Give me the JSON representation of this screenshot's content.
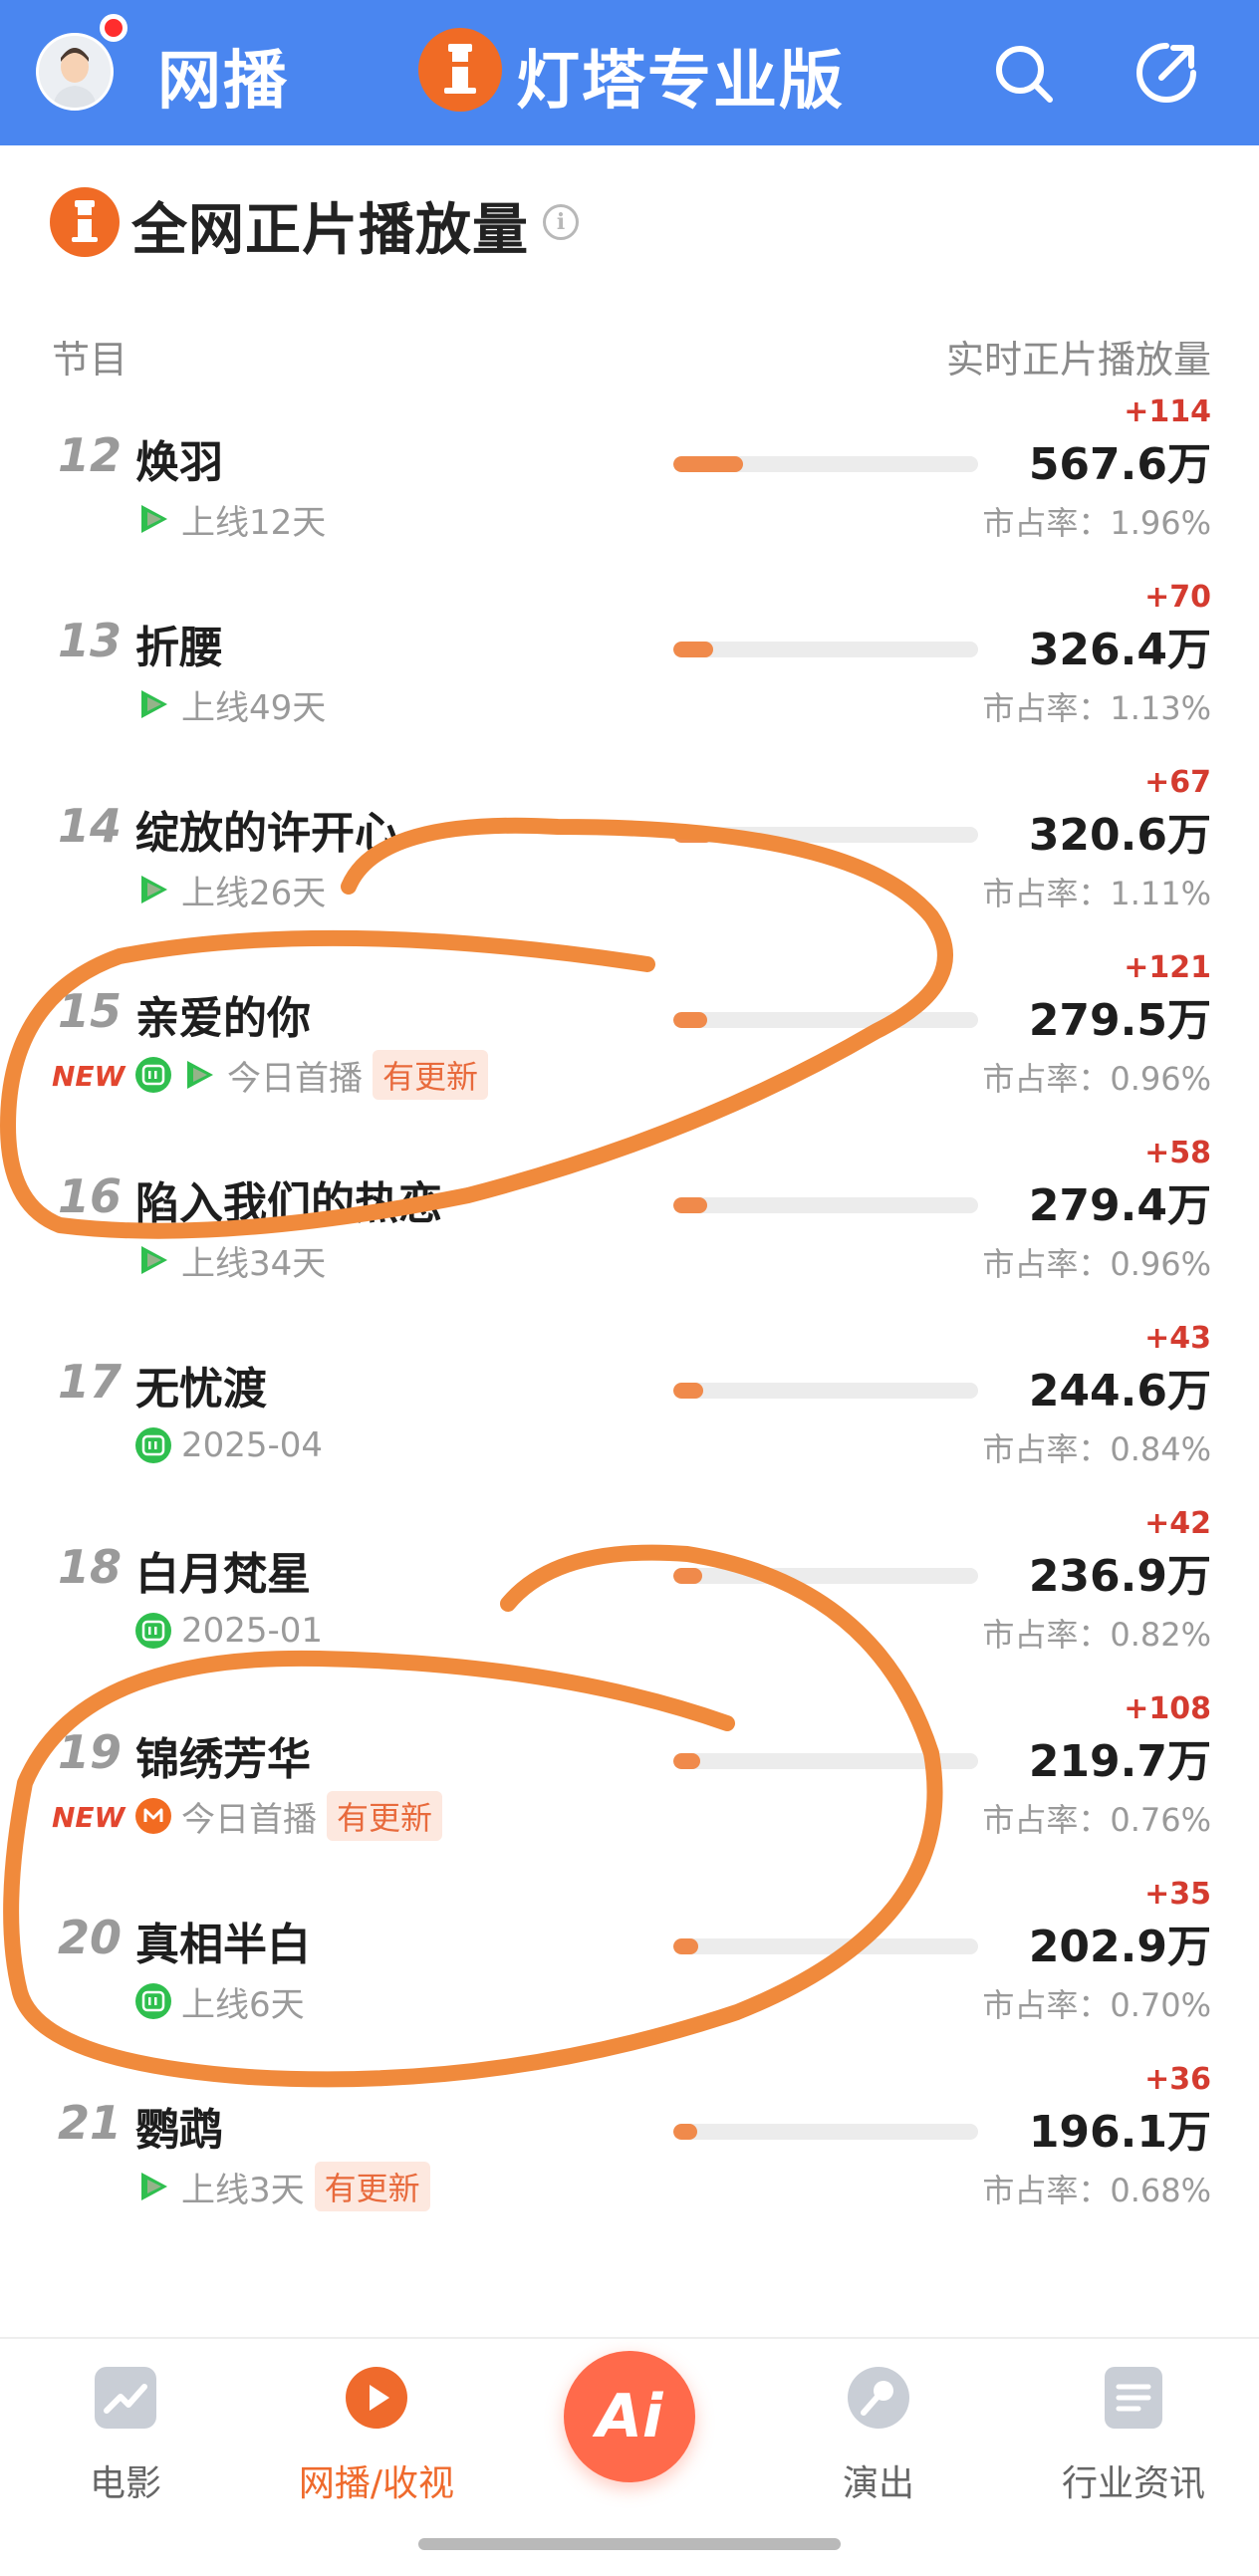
{
  "header": {
    "app_title": "网播",
    "brand_title": "灯塔专业版"
  },
  "section": {
    "title": "全网正片播放量",
    "col_left": "节目",
    "col_right": "实时正片播放量"
  },
  "rows": [
    {
      "rank": "12",
      "name": "焕羽",
      "platforms": [
        "tencent"
      ],
      "new": "",
      "meta_text": "上线12天",
      "update": "",
      "delta": "+114",
      "plays": "567.6万",
      "share": "市占率：1.96%",
      "share_value": 1.96
    },
    {
      "rank": "13",
      "name": "折腰",
      "platforms": [
        "tencent"
      ],
      "new": "",
      "meta_text": "上线49天",
      "update": "",
      "delta": "+70",
      "plays": "326.4万",
      "share": "市占率：1.13%",
      "share_value": 1.13
    },
    {
      "rank": "14",
      "name": "绽放的许开心",
      "platforms": [
        "tencent"
      ],
      "new": "",
      "meta_text": "上线26天",
      "update": "",
      "delta": "+67",
      "plays": "320.6万",
      "share": "市占率：1.11%",
      "share_value": 1.11
    },
    {
      "rank": "15",
      "name": "亲爱的你",
      "platforms": [
        "iqiyi",
        "tencent"
      ],
      "new": "NEW",
      "meta_text": "今日首播",
      "update": "有更新",
      "delta": "+121",
      "plays": "279.5万",
      "share": "市占率：0.96%",
      "share_value": 0.96
    },
    {
      "rank": "16",
      "name": "陷入我们的热恋",
      "platforms": [
        "tencent"
      ],
      "new": "",
      "meta_text": "上线34天",
      "update": "",
      "delta": "+58",
      "plays": "279.4万",
      "share": "市占率：0.96%",
      "share_value": 0.96
    },
    {
      "rank": "17",
      "name": "无忧渡",
      "platforms": [
        "iqiyi"
      ],
      "new": "",
      "meta_text": "2025-04",
      "update": "",
      "delta": "+43",
      "plays": "244.6万",
      "share": "市占率：0.84%",
      "share_value": 0.84
    },
    {
      "rank": "18",
      "name": "白月梵星",
      "platforms": [
        "iqiyi"
      ],
      "new": "",
      "meta_text": "2025-01",
      "update": "",
      "delta": "+42",
      "plays": "236.9万",
      "share": "市占率：0.82%",
      "share_value": 0.82
    },
    {
      "rank": "19",
      "name": "锦绣芳华",
      "platforms": [
        "mgtv"
      ],
      "new": "NEW",
      "meta_text": "今日首播",
      "update": "有更新",
      "delta": "+108",
      "plays": "219.7万",
      "share": "市占率：0.76%",
      "share_value": 0.76
    },
    {
      "rank": "20",
      "name": "真相半白",
      "platforms": [
        "iqiyi"
      ],
      "new": "",
      "meta_text": "上线6天",
      "update": "",
      "delta": "+35",
      "plays": "202.9万",
      "share": "市占率：0.70%",
      "share_value": 0.7
    },
    {
      "rank": "21",
      "name": "鹦鹉",
      "platforms": [
        "tencent"
      ],
      "new": "",
      "meta_text": "上线3天",
      "update": "有更新",
      "delta": "+36",
      "plays": "196.1万",
      "share": "市占率：0.68%",
      "share_value": 0.68
    }
  ],
  "tabbar": {
    "tabs": [
      {
        "label": "电影",
        "icon": "movie-icon"
      },
      {
        "label": "网播/收视",
        "icon": "play-icon",
        "active": true
      },
      {
        "label": "演出",
        "icon": "microphone-icon"
      },
      {
        "label": "行业资讯",
        "icon": "news-icon"
      }
    ],
    "fab_label": "Ai"
  },
  "colors": {
    "header_bg": "#4a86f0",
    "accent": "#ef6a2c",
    "delta_red": "#d43b2f",
    "bar_fill": "#f08a4b",
    "annotation": "#f08a3c"
  }
}
